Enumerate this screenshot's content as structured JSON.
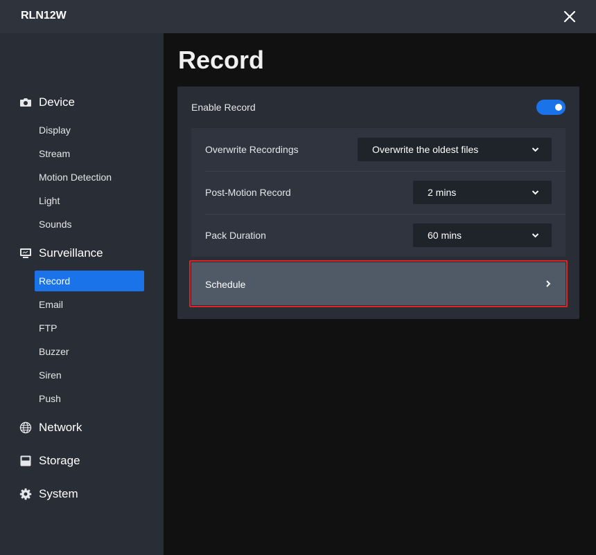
{
  "window": {
    "title": "RLN12W"
  },
  "sidebar": {
    "sections": [
      {
        "label": "Device",
        "icon": "camera-icon",
        "items": [
          "Display",
          "Stream",
          "Motion Detection",
          "Light",
          "Sounds"
        ]
      },
      {
        "label": "Surveillance",
        "icon": "monitor-icon",
        "items": [
          "Record",
          "Email",
          "FTP",
          "Buzzer",
          "Siren",
          "Push"
        ],
        "active_item": "Record"
      },
      {
        "label": "Network",
        "icon": "globe-icon",
        "items": []
      },
      {
        "label": "Storage",
        "icon": "storage-icon",
        "items": []
      },
      {
        "label": "System",
        "icon": "gear-icon",
        "items": []
      }
    ]
  },
  "main": {
    "title": "Record",
    "enable_record": {
      "label": "Enable Record",
      "enabled": true
    },
    "settings": [
      {
        "label": "Overwrite Recordings",
        "value": "Overwrite the oldest files"
      },
      {
        "label": "Post-Motion Record",
        "value": "2 mins"
      },
      {
        "label": "Pack Duration",
        "value": "60 mins"
      }
    ],
    "schedule": {
      "label": "Schedule",
      "highlighted": true
    }
  },
  "colors": {
    "accent": "#1a73e8",
    "highlight": "#e02424",
    "sidebar_bg": "#292d36",
    "page_bg": "#111111"
  }
}
